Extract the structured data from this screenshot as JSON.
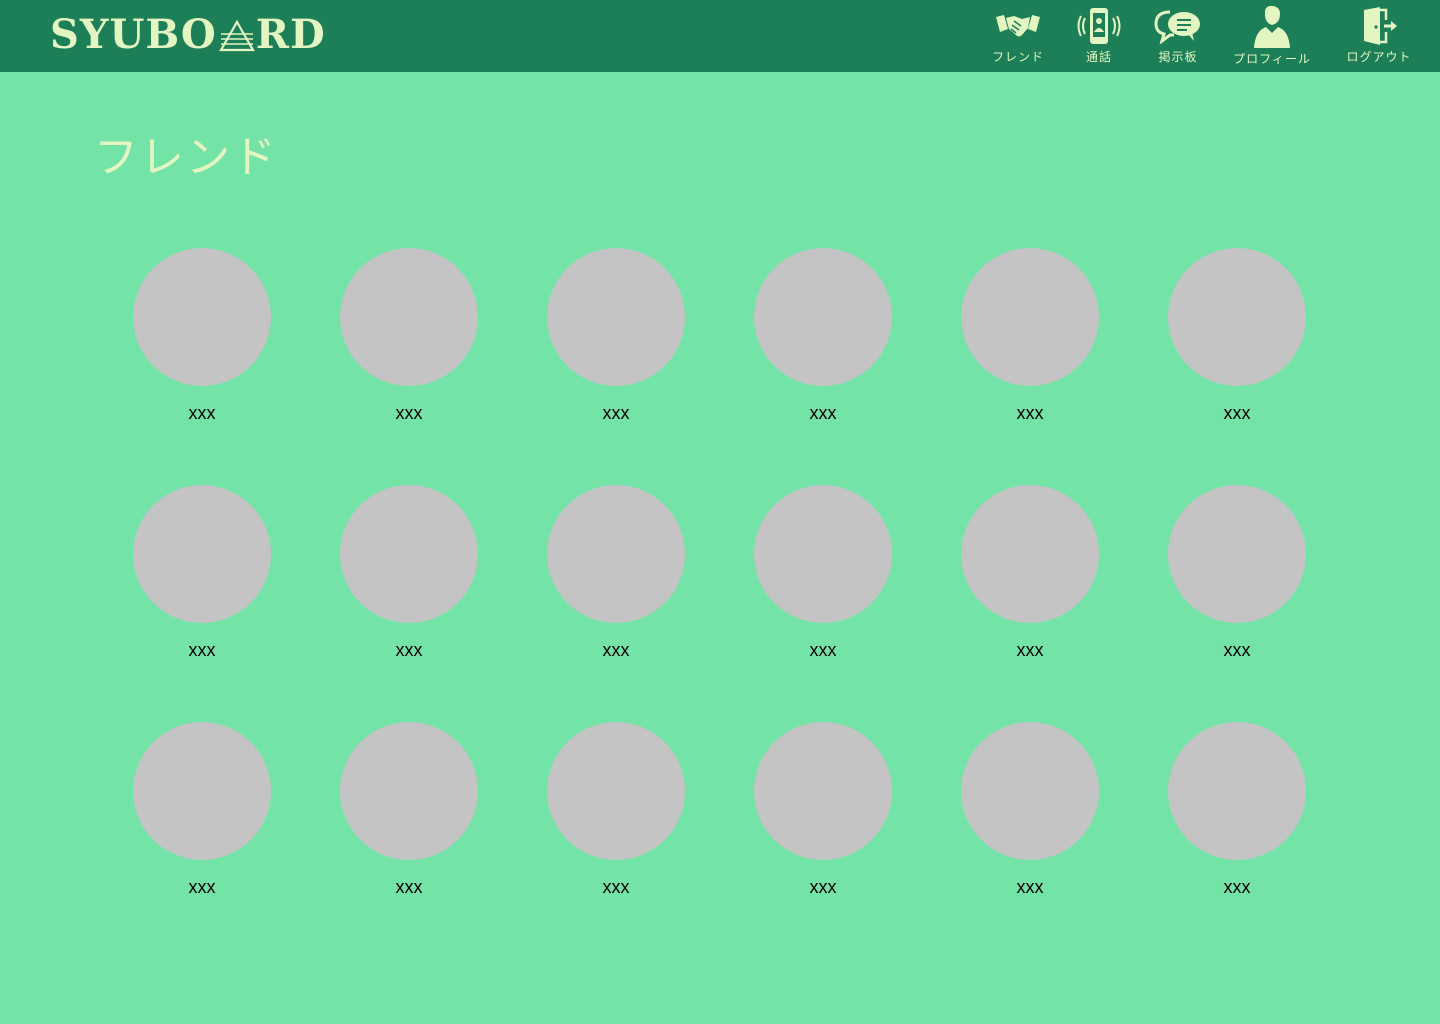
{
  "app": {
    "logo_left": "SYUBO",
    "logo_right": "RD"
  },
  "nav": {
    "items": [
      {
        "label": "フレンド",
        "icon": "handshake-icon"
      },
      {
        "label": "通話",
        "icon": "phone-call-icon"
      },
      {
        "label": "掲示板",
        "icon": "chat-bubbles-icon"
      },
      {
        "label": "プロフィール",
        "icon": "user-icon"
      },
      {
        "label": "ログアウト",
        "icon": "logout-door-icon"
      }
    ]
  },
  "page": {
    "title": "フレンド"
  },
  "friends": [
    {
      "name": "xxx"
    },
    {
      "name": "xxx"
    },
    {
      "name": "xxx"
    },
    {
      "name": "xxx"
    },
    {
      "name": "xxx"
    },
    {
      "name": "xxx"
    },
    {
      "name": "xxx"
    },
    {
      "name": "xxx"
    },
    {
      "name": "xxx"
    },
    {
      "name": "xxx"
    },
    {
      "name": "xxx"
    },
    {
      "name": "xxx"
    },
    {
      "name": "xxx"
    },
    {
      "name": "xxx"
    },
    {
      "name": "xxx"
    },
    {
      "name": "xxx"
    },
    {
      "name": "xxx"
    },
    {
      "name": "xxx"
    }
  ],
  "colors": {
    "header_bg": "#1c7f57",
    "page_bg": "#74e3a7",
    "accent_text": "#e3f6c1",
    "avatar_placeholder": "#c4c4c4"
  }
}
